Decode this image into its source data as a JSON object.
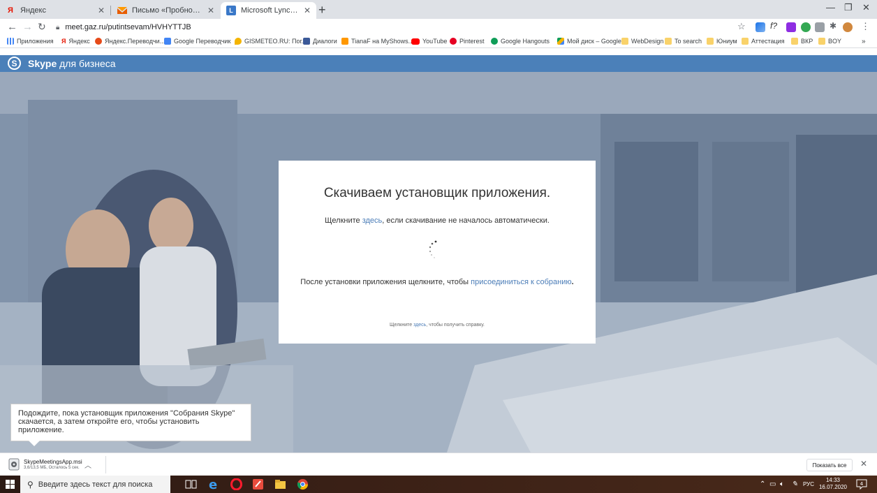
{
  "browser": {
    "tabs": [
      {
        "title": "Яндекс",
        "favicon": "yandex-icon",
        "color": "#e61400"
      },
      {
        "title": "Письмо «Пробное собрание» — ",
        "favicon": "mail-icon",
        "color": "#ff9900"
      },
      {
        "title": "Microsoft Lync Web App",
        "favicon": "lync-icon",
        "color": "#3a78c8"
      }
    ],
    "url": "meet.gaz.ru/putintsevam/HVHYTTJB",
    "bookmarks": [
      "Приложения",
      "Яндекс",
      "Яндекс.Переводчи...",
      "Google Переводчик",
      "GISMETEO.RU: Пог...",
      "Диалоги",
      "TianaF на MyShows...",
      "YouTube",
      "Pinterest",
      "Google Hangouts",
      "Мой диск – Google...",
      "WebDesign",
      "To search",
      "Юниум",
      "Аттестация",
      "ВКР",
      "BOY"
    ],
    "bookmarks_more": "»"
  },
  "skype": {
    "logo_letter": "S",
    "brand_bold": "Skype",
    "brand_rest": " для бизнеса",
    "accent": "#4b80b9"
  },
  "dialog": {
    "title": "Скачиваем установщик приложения.",
    "hint_before": "Щелкните ",
    "hint_link": "здесь",
    "hint_after": ", если скачивание не началось автоматически.",
    "after_before": "После установки приложения щелкните, чтобы ",
    "after_link": "присоединиться к собранию",
    "after_end": ".",
    "help_before": "Щелкните ",
    "help_link": "здесь",
    "help_after": ", чтобы получить справку."
  },
  "tooltip": {
    "text": "Подождите, пока установщик приложения \"Собрания Skype\" скачается, а затем откройте его, чтобы установить приложение."
  },
  "downloads": {
    "file_name": "SkypeMeetingsApp.msi",
    "status": "3,6/13,5 МБ, Осталось 5 сек.",
    "show_all": "Показать все"
  },
  "taskbar": {
    "search_placeholder": "Введите здесь текст для поиска",
    "language": "РУС",
    "time": "14:33",
    "date": "16.07.2020",
    "notifications": "4"
  }
}
